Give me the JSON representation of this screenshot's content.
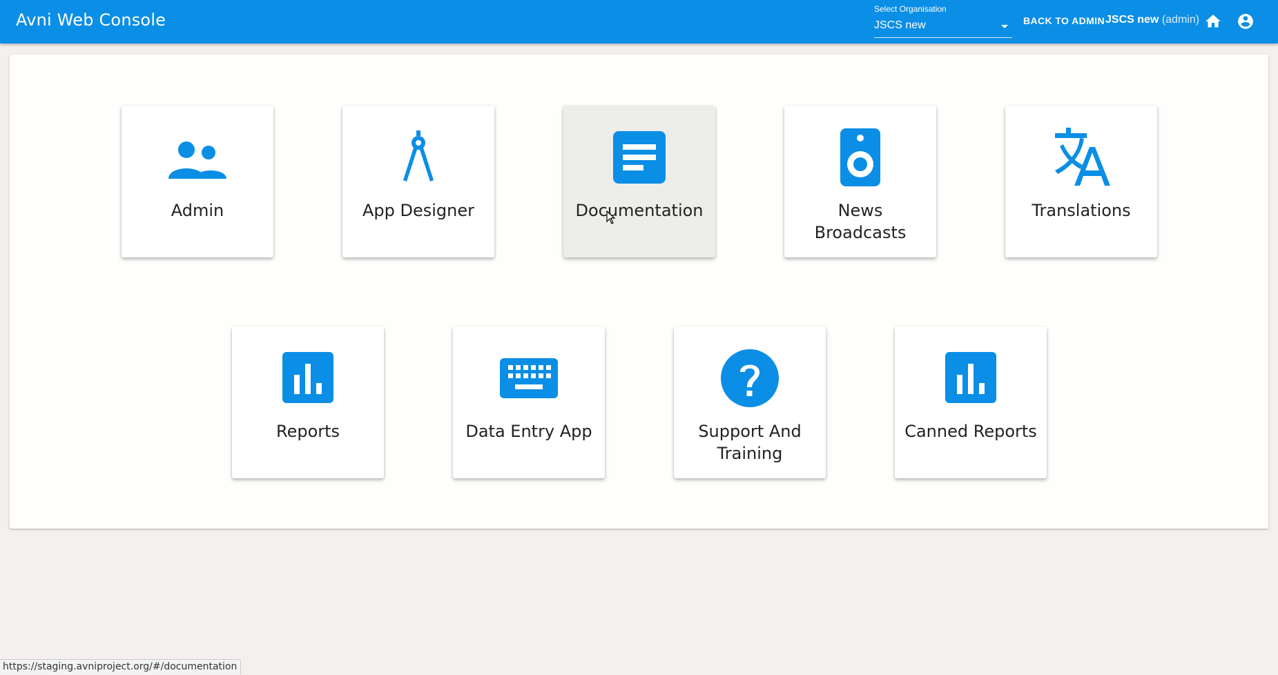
{
  "header": {
    "title": "Avni Web Console",
    "org_select": {
      "label": "Select Organisation",
      "value": "JSCS new"
    },
    "back_to_admin": "BACK TO ADMIN",
    "user_name": "JSCS new",
    "user_role": "(admin)",
    "icons": [
      "home-icon",
      "account-circle-icon"
    ]
  },
  "colors": {
    "primary": "#0b8ee5",
    "tile_icon": "#0b8ee5",
    "background": "#f5f0f0"
  },
  "tiles": [
    {
      "label": "Admin",
      "icon": "people-icon"
    },
    {
      "label": "App Designer",
      "icon": "compass-icon"
    },
    {
      "label": "Documentation",
      "icon": "description-icon",
      "hovered": true
    },
    {
      "label": "News Broadcasts",
      "icon": "speaker-icon"
    },
    {
      "label": "Translations",
      "icon": "translate-icon"
    },
    {
      "label": "Reports",
      "icon": "assessment-icon"
    },
    {
      "label": "Data Entry App",
      "icon": "keyboard-icon"
    },
    {
      "label": "Support And Training",
      "icon": "help-icon"
    },
    {
      "label": "Canned Reports",
      "icon": "assessment-icon"
    }
  ],
  "status_bar": {
    "url": "https://staging.avniproject.org/#/documentation"
  }
}
